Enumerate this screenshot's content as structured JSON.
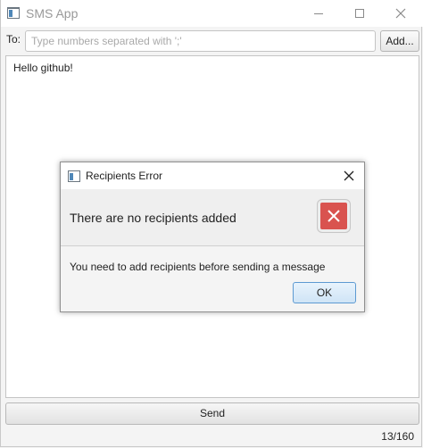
{
  "window": {
    "title": "SMS App",
    "minimize_glyph": "minimize-icon",
    "maximize_glyph": "maximize-icon",
    "close_glyph": "close-icon"
  },
  "to_row": {
    "label": "To:",
    "input_value": "",
    "input_placeholder": "Type numbers separated with ';'",
    "add_button_label": "Add..."
  },
  "message": {
    "text": "Hello github!"
  },
  "footer": {
    "send_button_label": "Send",
    "char_counter": "13/160"
  },
  "dialog": {
    "title": "Recipients Error",
    "header_text": "There are no recipients added",
    "content_text": "You need to add recipients before sending a message",
    "ok_button_label": "OK",
    "icon": "error-icon",
    "colors": {
      "error_icon_bg": "#d9534f",
      "ok_border": "#5d9ad2"
    }
  }
}
